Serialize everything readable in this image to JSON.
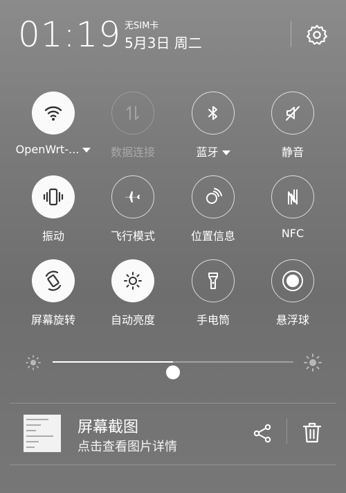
{
  "header": {
    "time": "01:19",
    "sim_status": "无SIM卡",
    "date": "5月3日 周二",
    "settings_icon": "gear-icon"
  },
  "toggles": [
    {
      "label": "OpenWrt-...",
      "state": "on",
      "icon": "wifi-icon",
      "has_dropdown": true
    },
    {
      "label": "数据连接",
      "state": "disabled",
      "icon": "mobile-data-icon",
      "has_dropdown": false
    },
    {
      "label": "蓝牙",
      "state": "off",
      "icon": "bluetooth-icon",
      "has_dropdown": true
    },
    {
      "label": "静音",
      "state": "off",
      "icon": "mute-icon",
      "has_dropdown": false
    },
    {
      "label": "振动",
      "state": "on",
      "icon": "vibrate-icon",
      "has_dropdown": false
    },
    {
      "label": "飞行模式",
      "state": "off",
      "icon": "airplane-icon",
      "has_dropdown": false
    },
    {
      "label": "位置信息",
      "state": "off",
      "icon": "location-icon",
      "has_dropdown": false
    },
    {
      "label": "NFC",
      "state": "off",
      "icon": "nfc-icon",
      "has_dropdown": false
    },
    {
      "label": "屏幕旋转",
      "state": "on",
      "icon": "rotate-icon",
      "has_dropdown": false
    },
    {
      "label": "自动亮度",
      "state": "on",
      "icon": "auto-brightness-icon",
      "has_dropdown": false
    },
    {
      "label": "手电筒",
      "state": "off",
      "icon": "flashlight-icon",
      "has_dropdown": false
    },
    {
      "label": "悬浮球",
      "state": "off",
      "icon": "floating-ball-icon",
      "has_dropdown": false
    }
  ],
  "brightness": {
    "level": 0.5
  },
  "notification": {
    "title": "屏幕截图",
    "text": "点击查看图片详情",
    "actions": [
      "share-icon",
      "trash-icon"
    ]
  },
  "colors": {
    "tile_on": "#fafafa",
    "icon_on": "#333333",
    "foreground": "#ffffff"
  }
}
